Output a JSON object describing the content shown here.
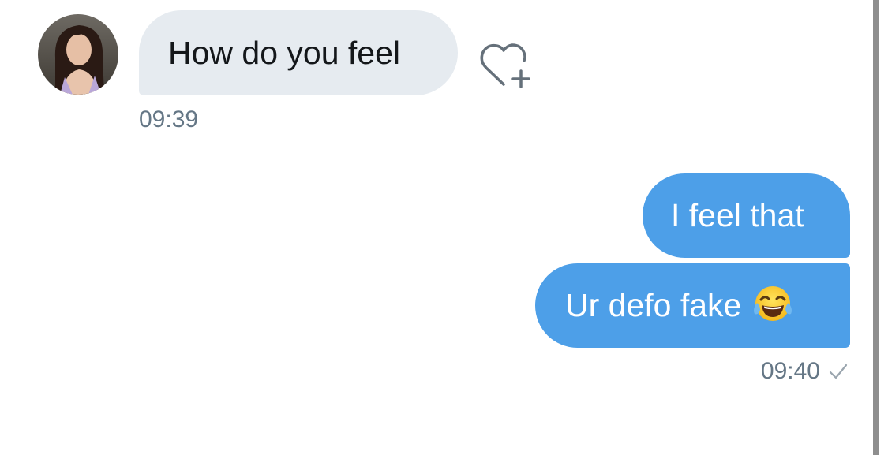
{
  "conversation": {
    "incoming": {
      "avatar_icon": "profile-photo",
      "message": "How do you feel",
      "time": "09:39",
      "reaction_icon": "heart-add-icon"
    },
    "outgoing": {
      "messages": [
        {
          "text": "I feel that"
        },
        {
          "text": "Ur defo fake",
          "emoji": "face-with-tears-of-joy"
        }
      ],
      "time": "09:40",
      "status_icon": "sent-check-icon"
    }
  },
  "colors": {
    "incoming_bubble": "#e6ebf0",
    "outgoing_bubble": "#4d9fe8",
    "timestamp": "#657786",
    "text_dark": "#14171a"
  }
}
